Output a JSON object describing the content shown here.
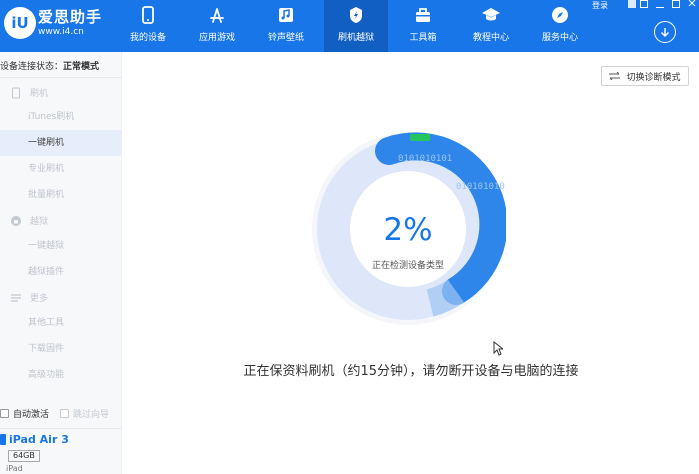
{
  "app": {
    "logo_text": "iU",
    "name": "爱思助手",
    "url": "www.i4.cn"
  },
  "nav": [
    {
      "label": "我的设备",
      "icon": "phone-icon"
    },
    {
      "label": "应用游戏",
      "icon": "app-store-icon"
    },
    {
      "label": "铃声壁纸",
      "icon": "music-icon"
    },
    {
      "label": "刷机越狱",
      "icon": "flash-icon",
      "active": true
    },
    {
      "label": "工具箱",
      "icon": "toolbox-icon"
    },
    {
      "label": "教程中心",
      "icon": "graduation-cap-icon"
    },
    {
      "label": "服务中心",
      "icon": "compass-icon"
    }
  ],
  "window_controls": {
    "login": "登录"
  },
  "sidebar": {
    "connection_label": "设备连接状态：",
    "connection_value": "正常模式",
    "groups": [
      {
        "label": "刷机",
        "icon": "phone-flash-icon",
        "items": [
          {
            "label": "iTunes刷机"
          },
          {
            "label": "一键刷机",
            "active": true
          },
          {
            "label": "专业刷机"
          },
          {
            "label": "批量刷机"
          }
        ]
      },
      {
        "label": "越狱",
        "icon": "jailbreak-icon",
        "items": [
          {
            "label": "一键越狱"
          },
          {
            "label": "越狱插件"
          }
        ]
      },
      {
        "label": "更多",
        "icon": "menu-icon",
        "items": [
          {
            "label": "其他工具"
          },
          {
            "label": "下载固件"
          },
          {
            "label": "高级功能"
          }
        ]
      }
    ],
    "checkboxes": {
      "auto_activate": "自动激活",
      "skip_guide": "跳过向导"
    },
    "device": {
      "name": "iPad Air 3",
      "capacity": "64GB",
      "type": "iPad"
    }
  },
  "main": {
    "diag_button": "切换诊断模式",
    "progress_percent_text": "2%",
    "progress_value": 0.02,
    "progress_status": "正在检测设备类型",
    "message": "正在保资料刷机（约15分钟），请勿断开设备与电脑的连接",
    "binary_text": "0101010101",
    "colors": {
      "brand_blue": "#1976e8",
      "ring_blue": "#2f86ea",
      "ring_light": "#dde7f9",
      "indicator_green": "#22c55e"
    }
  }
}
